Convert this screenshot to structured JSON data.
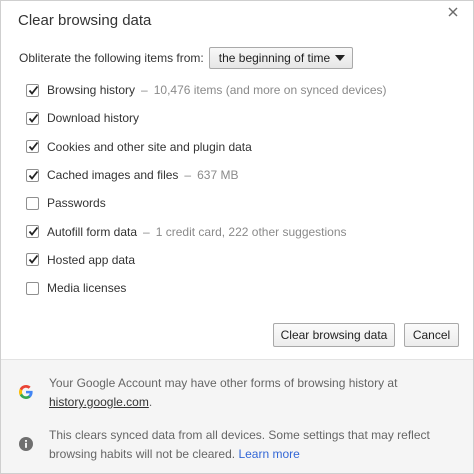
{
  "dialog": {
    "title": "Clear browsing data"
  },
  "range": {
    "label": "Obliterate the following items from:",
    "selected": "the beginning of time"
  },
  "items": [
    {
      "label": "Browsing history",
      "detail": "10,476 items (and more on synced devices)",
      "checked": true
    },
    {
      "label": "Download history",
      "detail": "",
      "checked": true
    },
    {
      "label": "Cookies and other site and plugin data",
      "detail": "",
      "checked": true
    },
    {
      "label": "Cached images and files",
      "detail": "637 MB",
      "checked": true
    },
    {
      "label": "Passwords",
      "detail": "",
      "checked": false
    },
    {
      "label": "Autofill form data",
      "detail": "1 credit card, 222 other suggestions",
      "checked": true
    },
    {
      "label": "Hosted app data",
      "detail": "",
      "checked": true
    },
    {
      "label": "Media licenses",
      "detail": "",
      "checked": false
    }
  ],
  "detail_separator": "–",
  "buttons": {
    "clear": "Clear browsing data",
    "cancel": "Cancel"
  },
  "footer": {
    "google_note": {
      "text": "Your Google Account may have other forms of browsing history at",
      "link": "history.google.com",
      "suffix": "."
    },
    "sync_note": {
      "text": "This clears synced data from all devices. Some settings that may reflect browsing habits will not be cleared.",
      "link": "Learn more"
    }
  },
  "icons": {
    "close": "close-icon",
    "select_arrow": "dropdown-arrow-icon",
    "checkmark": "checkmark-icon",
    "google": "google-g-icon",
    "info": "info-icon"
  },
  "colors": {
    "link": "#3367d6",
    "detail_text": "#8a8a8a",
    "footer_bg": "#f5f5f5"
  }
}
